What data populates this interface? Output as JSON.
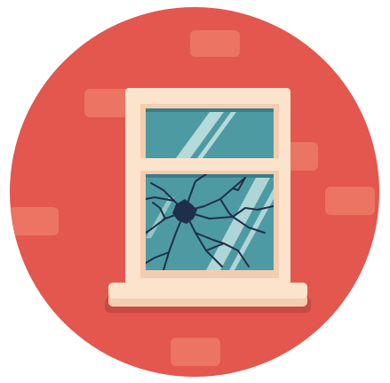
{
  "illustration": {
    "subject": "broken-window-icon",
    "colors": {
      "circle_background": "#e3574e",
      "brick": "#eb7462",
      "frame_light": "#fbe3cc",
      "frame_mid": "#f3cdb0",
      "frame_shadow": "#d9a88a",
      "glass": "#4e9aa2",
      "glass_dark": "#3a7d88",
      "glass_shine": "#c7e5e3",
      "crack": "#1f2f4a",
      "sill_shadow": "#c84a42"
    }
  }
}
